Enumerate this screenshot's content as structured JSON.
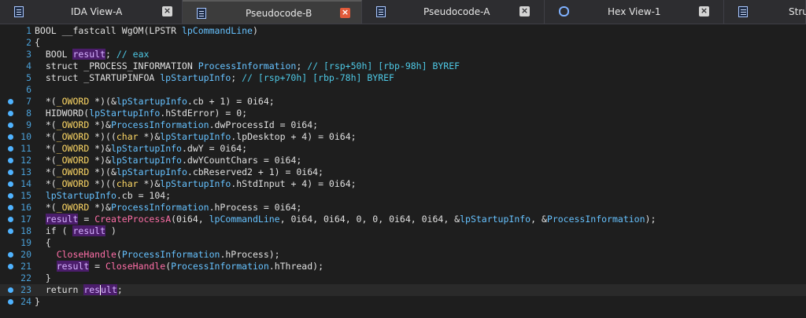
{
  "tabs": [
    {
      "label": "IDA View-A",
      "icon": "document-icon",
      "active": false,
      "closable": true
    },
    {
      "label": "Pseudocode-B",
      "icon": "document-icon",
      "active": true,
      "closable": true
    },
    {
      "label": "Pseudocode-A",
      "icon": "document-icon",
      "active": false,
      "closable": true
    },
    {
      "label": "Hex View-1",
      "icon": "hex-icon",
      "active": false,
      "closable": true
    },
    {
      "label": "Struc",
      "icon": "structures-icon",
      "active": false,
      "closable": false
    }
  ],
  "close_glyph": "×",
  "colors": {
    "background": "#1e1e1e",
    "keyword": "#e0e0e0",
    "type": "#ffd966",
    "function": "#ff6fa8",
    "variable": "#66c2ff",
    "comment": "#4ec9e6",
    "line_number": "#4a9fd6",
    "breakpoint": "#4fb3ff",
    "highlight": "#4b1d6b"
  },
  "code": [
    {
      "n": "1",
      "bp": false,
      "tokens": [
        [
          "t",
          "BOOL __fastcall "
        ],
        [
          "t",
          "WgOM"
        ],
        [
          "t",
          "(LPSTR "
        ],
        [
          "v",
          "lpCommandLine"
        ],
        [
          "t",
          ")"
        ]
      ]
    },
    {
      "n": "2",
      "bp": false,
      "tokens": [
        [
          "t",
          "{"
        ]
      ]
    },
    {
      "n": "3",
      "bp": false,
      "tokens": [
        [
          "t",
          "  BOOL "
        ],
        [
          "h",
          "result"
        ],
        [
          "t",
          "; "
        ],
        [
          "c",
          "// eax"
        ]
      ]
    },
    {
      "n": "4",
      "bp": false,
      "tokens": [
        [
          "t",
          "  struct _PROCESS_INFORMATION "
        ],
        [
          "v",
          "ProcessInformation"
        ],
        [
          "t",
          "; "
        ],
        [
          "c",
          "// [rsp+50h] [rbp-98h] BYREF"
        ]
      ]
    },
    {
      "n": "5",
      "bp": false,
      "tokens": [
        [
          "t",
          "  struct _STARTUPINFOA "
        ],
        [
          "v",
          "lpStartupInfo"
        ],
        [
          "t",
          "; "
        ],
        [
          "c",
          "// [rsp+70h] [rbp-78h] BYREF"
        ]
      ]
    },
    {
      "n": "6",
      "bp": false,
      "tokens": []
    },
    {
      "n": "7",
      "bp": true,
      "tokens": [
        [
          "t",
          "  *("
        ],
        [
          "y",
          "_OWORD"
        ],
        [
          "t",
          " *)(&"
        ],
        [
          "v",
          "lpStartupInfo"
        ],
        [
          "t",
          ".cb + 1) = 0i64;"
        ]
      ]
    },
    {
      "n": "8",
      "bp": true,
      "tokens": [
        [
          "t",
          "  HIDWORD("
        ],
        [
          "v",
          "lpStartupInfo"
        ],
        [
          "t",
          ".hStdError) = 0;"
        ]
      ]
    },
    {
      "n": "9",
      "bp": true,
      "tokens": [
        [
          "t",
          "  *("
        ],
        [
          "y",
          "_OWORD"
        ],
        [
          "t",
          " *)&"
        ],
        [
          "v",
          "ProcessInformation"
        ],
        [
          "t",
          ".dwProcessId = 0i64;"
        ]
      ]
    },
    {
      "n": "10",
      "bp": true,
      "tokens": [
        [
          "t",
          "  *("
        ],
        [
          "y",
          "_OWORD"
        ],
        [
          "t",
          " *)(("
        ],
        [
          "y",
          "char"
        ],
        [
          "t",
          " *)&"
        ],
        [
          "v",
          "lpStartupInfo"
        ],
        [
          "t",
          ".lpDesktop + 4) = 0i64;"
        ]
      ]
    },
    {
      "n": "11",
      "bp": true,
      "tokens": [
        [
          "t",
          "  *("
        ],
        [
          "y",
          "_OWORD"
        ],
        [
          "t",
          " *)&"
        ],
        [
          "v",
          "lpStartupInfo"
        ],
        [
          "t",
          ".dwY = 0i64;"
        ]
      ]
    },
    {
      "n": "12",
      "bp": true,
      "tokens": [
        [
          "t",
          "  *("
        ],
        [
          "y",
          "_OWORD"
        ],
        [
          "t",
          " *)&"
        ],
        [
          "v",
          "lpStartupInfo"
        ],
        [
          "t",
          ".dwYCountChars = 0i64;"
        ]
      ]
    },
    {
      "n": "13",
      "bp": true,
      "tokens": [
        [
          "t",
          "  *("
        ],
        [
          "y",
          "_OWORD"
        ],
        [
          "t",
          " *)(&"
        ],
        [
          "v",
          "lpStartupInfo"
        ],
        [
          "t",
          ".cbReserved2 + 1) = 0i64;"
        ]
      ]
    },
    {
      "n": "14",
      "bp": true,
      "tokens": [
        [
          "t",
          "  *("
        ],
        [
          "y",
          "_OWORD"
        ],
        [
          "t",
          " *)(("
        ],
        [
          "y",
          "char"
        ],
        [
          "t",
          " *)&"
        ],
        [
          "v",
          "lpStartupInfo"
        ],
        [
          "t",
          ".hStdInput + 4) = 0i64;"
        ]
      ]
    },
    {
      "n": "15",
      "bp": true,
      "tokens": [
        [
          "t",
          "  "
        ],
        [
          "v",
          "lpStartupInfo"
        ],
        [
          "t",
          ".cb = 104;"
        ]
      ]
    },
    {
      "n": "16",
      "bp": true,
      "tokens": [
        [
          "t",
          "  *("
        ],
        [
          "y",
          "_OWORD"
        ],
        [
          "t",
          " *)&"
        ],
        [
          "v",
          "ProcessInformation"
        ],
        [
          "t",
          ".hProcess = 0i64;"
        ]
      ]
    },
    {
      "n": "17",
      "bp": true,
      "tokens": [
        [
          "t",
          "  "
        ],
        [
          "h",
          "result"
        ],
        [
          "t",
          " = "
        ],
        [
          "f",
          "CreateProcessA"
        ],
        [
          "t",
          "(0i64, "
        ],
        [
          "v",
          "lpCommandLine"
        ],
        [
          "t",
          ", 0i64, 0i64, 0, 0, 0i64, 0i64, &"
        ],
        [
          "v",
          "lpStartupInfo"
        ],
        [
          "t",
          ", &"
        ],
        [
          "v",
          "ProcessInformation"
        ],
        [
          "t",
          ");"
        ]
      ]
    },
    {
      "n": "18",
      "bp": true,
      "tokens": [
        [
          "t",
          "  if ( "
        ],
        [
          "h",
          "result"
        ],
        [
          "t",
          " )"
        ]
      ]
    },
    {
      "n": "19",
      "bp": false,
      "tokens": [
        [
          "t",
          "  {"
        ]
      ]
    },
    {
      "n": "20",
      "bp": true,
      "tokens": [
        [
          "t",
          "    "
        ],
        [
          "f",
          "CloseHandle"
        ],
        [
          "t",
          "("
        ],
        [
          "v",
          "ProcessInformation"
        ],
        [
          "t",
          ".hProcess);"
        ]
      ]
    },
    {
      "n": "21",
      "bp": true,
      "tokens": [
        [
          "t",
          "    "
        ],
        [
          "h",
          "result"
        ],
        [
          "t",
          " = "
        ],
        [
          "f",
          "CloseHandle"
        ],
        [
          "t",
          "("
        ],
        [
          "v",
          "ProcessInformation"
        ],
        [
          "t",
          ".hThread);"
        ]
      ]
    },
    {
      "n": "22",
      "bp": false,
      "tokens": [
        [
          "t",
          "  }"
        ]
      ]
    },
    {
      "n": "23",
      "bp": true,
      "current": true,
      "tokens": [
        [
          "t",
          "  return "
        ],
        [
          "h",
          "res"
        ],
        [
          "cur",
          ""
        ],
        [
          "h",
          "ult"
        ],
        [
          "t",
          ";"
        ]
      ]
    },
    {
      "n": "24",
      "bp": true,
      "tokens": [
        [
          "t",
          "}"
        ]
      ]
    }
  ]
}
